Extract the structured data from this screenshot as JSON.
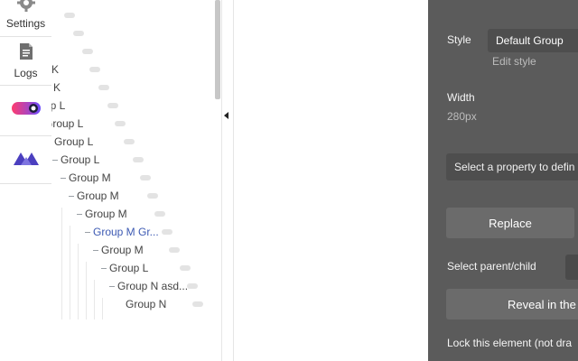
{
  "sidebar": {
    "items": [
      {
        "label": "Settings",
        "icon": "gear-icon"
      },
      {
        "label": "Logs",
        "icon": "document-icon"
      },
      {
        "label": "",
        "icon": "toggle-plugin-icon"
      },
      {
        "label": "",
        "icon": "brand-logo-icon"
      }
    ]
  },
  "tree": {
    "items": [
      {
        "label": "K"
      },
      {
        "label": "p K"
      },
      {
        "label": "up L"
      },
      {
        "label": "Group L"
      },
      {
        "label": "Group L"
      },
      {
        "label": "Group L"
      },
      {
        "label": "Group M"
      },
      {
        "label": "Group M"
      },
      {
        "label": "Group M"
      },
      {
        "label": "Group M Gr..."
      },
      {
        "label": "Group M"
      },
      {
        "label": "Group L"
      },
      {
        "label": "Group N asd..."
      },
      {
        "label": "Group N"
      }
    ],
    "active_index": 9
  },
  "properties": {
    "style_label": "Style",
    "style_value": "Default Group",
    "edit_style": "Edit style",
    "width_label": "Width",
    "width_value": "280px",
    "property_placeholder": "Select a property to defin",
    "replace_label": "Replace",
    "parent_child_label": "Select parent/child",
    "reveal_label": "Reveal in the",
    "lock_label": "Lock this element (not dra"
  },
  "colors": {
    "panel_bg": "#5b5b5b",
    "button_bg": "#6b6b6b",
    "active_tree_item": "#3d5ab3",
    "brand_logo": "#4b3fbf"
  }
}
